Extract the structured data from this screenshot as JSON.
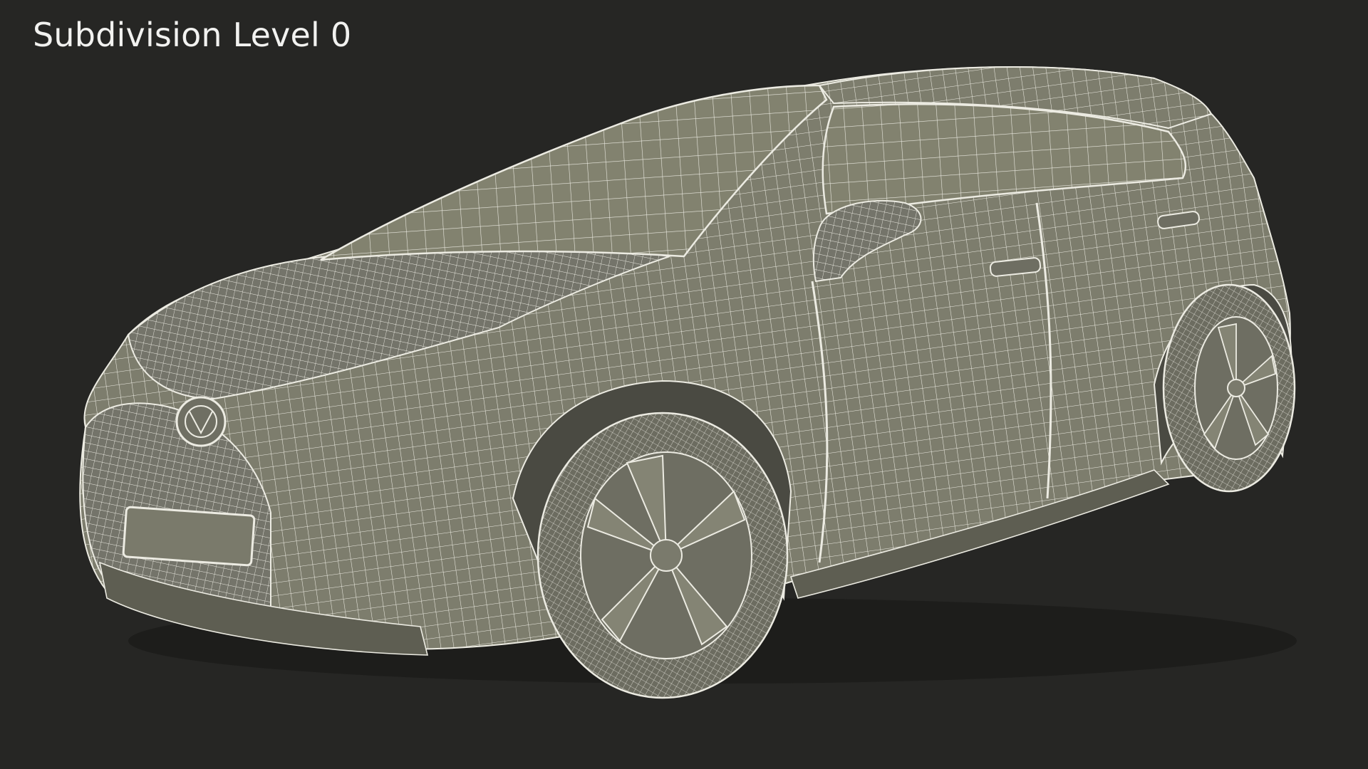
{
  "caption": {
    "text": "Subdivision Level 0"
  },
  "render": {
    "subject": "car-wireframe-model",
    "colors": {
      "background": "#262624",
      "surface": "#7d7d6d",
      "surface_dark": "#5e5e52",
      "wire": "#ecebe2",
      "caption_text": "#f2f2f0"
    }
  }
}
